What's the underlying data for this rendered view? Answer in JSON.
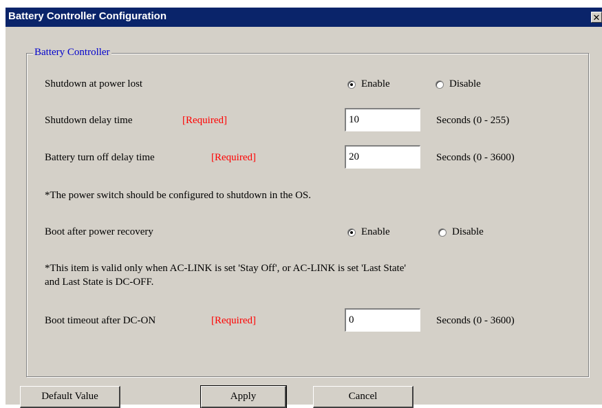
{
  "window": {
    "title": "Battery Controller Configuration",
    "close_glyph": "✕"
  },
  "group": {
    "legend": "Battery Controller"
  },
  "rows": {
    "shutdown_power_lost": {
      "label": "Shutdown at power lost",
      "enable_label": "Enable",
      "disable_label": "Disable",
      "selected": "enable"
    },
    "shutdown_delay": {
      "label": "Shutdown delay time",
      "required": "[Required]",
      "value": "10",
      "range": "Seconds (0 - 255)"
    },
    "battery_off_delay": {
      "label": "Battery turn off delay time",
      "required": "[Required]",
      "value": "20",
      "range": "Seconds (0 - 3600)"
    },
    "note_power_switch": "*The power switch should be configured to shutdown in the OS.",
    "boot_after_recovery": {
      "label": "Boot after power recovery",
      "enable_label": "Enable",
      "disable_label": "Disable",
      "selected": "enable"
    },
    "note_ac_link_line1": "*This item is valid only when AC-LINK is set 'Stay Off', or AC-LINK is set 'Last State'",
    "note_ac_link_line2": "and Last State is DC-OFF.",
    "boot_timeout": {
      "label": "Boot timeout after DC-ON",
      "required": "[Required]",
      "value": "0",
      "range": "Seconds (0 - 3600)"
    }
  },
  "buttons": {
    "default_value": "Default Value",
    "apply": "Apply",
    "cancel": "Cancel"
  },
  "colors": {
    "titlebar": "#0a246a",
    "dialog_bg": "#d4d0c8",
    "legend": "#0000cc",
    "required": "#ff0000"
  }
}
